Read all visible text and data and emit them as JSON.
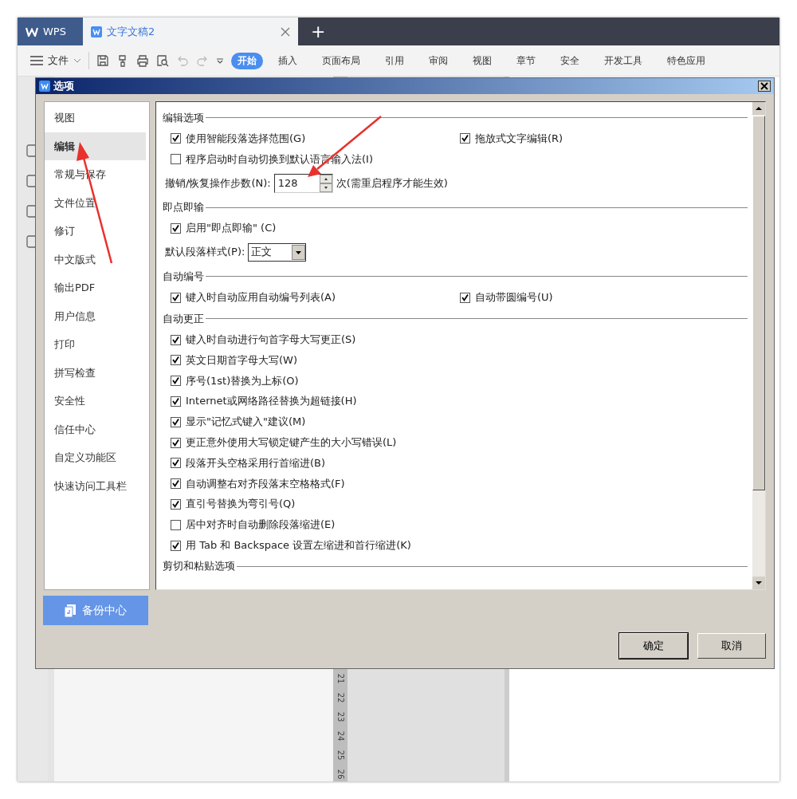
{
  "app_tabs": [
    {
      "label": "WPS",
      "kind": "home",
      "selected": false
    },
    {
      "label": "文字文稿2",
      "kind": "document",
      "selected": true
    }
  ],
  "new_tab": "+",
  "toolbar": {
    "file_menu": "文件",
    "ribbon_tabs": [
      {
        "label": "开始",
        "selected": true
      },
      {
        "label": "插入",
        "selected": false
      },
      {
        "label": "页面布局",
        "selected": false
      },
      {
        "label": "引用",
        "selected": false
      },
      {
        "label": "审阅",
        "selected": false
      },
      {
        "label": "视图",
        "selected": false
      },
      {
        "label": "章节",
        "selected": false
      },
      {
        "label": "安全",
        "selected": false
      },
      {
        "label": "开发工具",
        "selected": false
      },
      {
        "label": "特色应用",
        "selected": false
      }
    ]
  },
  "ruler_numbers": [
    "21",
    "22",
    "23",
    "24",
    "25",
    "26"
  ],
  "dialog": {
    "title": "选项",
    "nav": [
      {
        "label": "视图",
        "selected": false
      },
      {
        "label": "编辑",
        "selected": true
      },
      {
        "label": "常规与保存",
        "selected": false
      },
      {
        "label": "文件位置",
        "selected": false
      },
      {
        "label": "修订",
        "selected": false
      },
      {
        "label": "中文版式",
        "selected": false
      },
      {
        "label": "输出PDF",
        "selected": false
      },
      {
        "label": "用户信息",
        "selected": false
      },
      {
        "label": "打印",
        "selected": false
      },
      {
        "label": "拼写检查",
        "selected": false
      },
      {
        "label": "安全性",
        "selected": false
      },
      {
        "label": "信任中心",
        "selected": false
      },
      {
        "label": "自定义功能区",
        "selected": false
      },
      {
        "label": "快速访问工具栏",
        "selected": false
      }
    ],
    "sections": [
      {
        "title": "编辑选项",
        "rows": [
          {
            "kind": "checks",
            "items": [
              {
                "label": "使用智能段落选择范围(G)",
                "checked": true
              },
              {
                "label": "拖放式文字编辑(R)",
                "checked": true
              }
            ]
          },
          {
            "kind": "checks",
            "items": [
              {
                "label": "程序启动时自动切换到默认语言输入法(I)",
                "checked": false
              }
            ]
          },
          {
            "kind": "spinner",
            "label": "撤销/恢复操作步数(N):",
            "value": "128",
            "suffix": "次(需重启程序才能生效)"
          }
        ]
      },
      {
        "title": "即点即输",
        "rows": [
          {
            "kind": "checks",
            "items": [
              {
                "label": "启用\"即点即输\" (C)",
                "checked": true
              }
            ]
          },
          {
            "kind": "select",
            "label": "默认段落样式(P):",
            "value": "正文"
          }
        ]
      },
      {
        "title": "自动编号",
        "rows": [
          {
            "kind": "checks",
            "items": [
              {
                "label": "键入时自动应用自动编号列表(A)",
                "checked": true
              },
              {
                "label": "自动带圆编号(U)",
                "checked": true
              }
            ]
          }
        ]
      },
      {
        "title": "自动更正",
        "rows": [
          {
            "kind": "checks",
            "items": [
              {
                "label": "键入时自动进行句首字母大写更正(S)",
                "checked": true
              }
            ]
          },
          {
            "kind": "checks",
            "items": [
              {
                "label": "英文日期首字母大写(W)",
                "checked": true
              }
            ]
          },
          {
            "kind": "checks",
            "items": [
              {
                "label": "序号(1st)替换为上标(O)",
                "checked": true
              }
            ]
          },
          {
            "kind": "checks",
            "items": [
              {
                "label": "Internet或网络路径替换为超链接(H)",
                "checked": true
              }
            ]
          },
          {
            "kind": "checks",
            "items": [
              {
                "label": "显示\"记忆式键入\"建议(M)",
                "checked": true
              }
            ]
          },
          {
            "kind": "checks",
            "items": [
              {
                "label": "更正意外使用大写锁定键产生的大小写错误(L)",
                "checked": true
              }
            ]
          },
          {
            "kind": "checks",
            "items": [
              {
                "label": "段落开头空格采用行首缩进(B)",
                "checked": true
              }
            ]
          },
          {
            "kind": "checks",
            "items": [
              {
                "label": "自动调整右对齐段落末空格格式(F)",
                "checked": true
              }
            ]
          },
          {
            "kind": "checks",
            "items": [
              {
                "label": "直引号替换为弯引号(Q)",
                "checked": true
              }
            ]
          },
          {
            "kind": "checks",
            "items": [
              {
                "label": "居中对齐时自动删除段落缩进(E)",
                "checked": false
              }
            ]
          },
          {
            "kind": "checks",
            "items": [
              {
                "label": "用 Tab 和 Backspace 设置左缩进和首行缩进(K)",
                "checked": true
              }
            ]
          }
        ]
      },
      {
        "title": "剪切和粘贴选项"
      }
    ],
    "backup_button": "备份中心",
    "buttons": [
      "确定",
      "取消"
    ]
  }
}
